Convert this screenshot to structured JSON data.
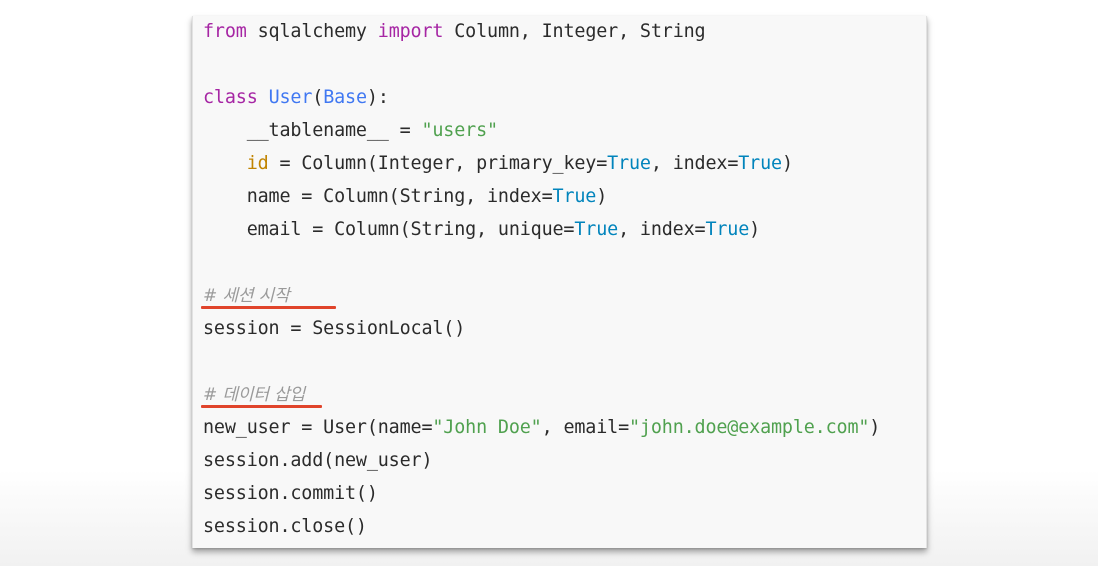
{
  "code_block": {
    "lines": [
      {
        "tokens": [
          {
            "t": "from",
            "k": "kw"
          },
          {
            "t": " sqlalchemy ",
            "k": "plain"
          },
          {
            "t": "import",
            "k": "kw"
          },
          {
            "t": " Column, Integer, String",
            "k": "plain"
          }
        ]
      },
      {
        "tokens": [
          {
            "t": "class",
            "k": "kw"
          },
          {
            "t": " ",
            "k": "plain"
          },
          {
            "t": "User",
            "k": "cls"
          },
          {
            "t": "(",
            "k": "plain"
          },
          {
            "t": "Base",
            "k": "cls"
          },
          {
            "t": "):",
            "k": "plain"
          }
        ]
      },
      {
        "tokens": [
          {
            "t": "    __tablename__ = ",
            "k": "plain"
          },
          {
            "t": "\"users\"",
            "k": "str"
          }
        ]
      },
      {
        "tokens": [
          {
            "t": "    ",
            "k": "plain"
          },
          {
            "t": "id",
            "k": "attr"
          },
          {
            "t": " = Column(Integer, primary_key=",
            "k": "plain"
          },
          {
            "t": "True",
            "k": "bool"
          },
          {
            "t": ", index=",
            "k": "plain"
          },
          {
            "t": "True",
            "k": "bool"
          },
          {
            "t": ")",
            "k": "plain"
          }
        ]
      },
      {
        "tokens": [
          {
            "t": "    name = Column(String, index=",
            "k": "plain"
          },
          {
            "t": "True",
            "k": "bool"
          },
          {
            "t": ")",
            "k": "plain"
          }
        ]
      },
      {
        "tokens": [
          {
            "t": "    email = Column(String, unique=",
            "k": "plain"
          },
          {
            "t": "True",
            "k": "bool"
          },
          {
            "t": ", index=",
            "k": "plain"
          },
          {
            "t": "True",
            "k": "bool"
          },
          {
            "t": ")",
            "k": "plain"
          }
        ]
      },
      {
        "tokens": [
          {
            "t": "# 세션 시작",
            "k": "cmt"
          }
        ]
      },
      {
        "tokens": [
          {
            "t": "session = SessionLocal()",
            "k": "plain"
          }
        ]
      },
      {
        "tokens": [
          {
            "t": "# 데이터 삽입",
            "k": "cmt"
          }
        ]
      },
      {
        "tokens": [
          {
            "t": "new_user = User(name=",
            "k": "plain"
          },
          {
            "t": "\"John Doe\"",
            "k": "str"
          },
          {
            "t": ", email=",
            "k": "plain"
          },
          {
            "t": "\"john.doe@example.com\"",
            "k": "str"
          },
          {
            "t": ")",
            "k": "plain"
          }
        ]
      },
      {
        "tokens": [
          {
            "t": "session.add(new_user)",
            "k": "plain"
          }
        ]
      },
      {
        "tokens": [
          {
            "t": "session.commit()",
            "k": "plain"
          }
        ]
      },
      {
        "tokens": [
          {
            "t": "session.close()",
            "k": "plain"
          }
        ]
      }
    ]
  },
  "colors": {
    "keyword": "#a626a4",
    "class_name": "#4078f2",
    "string": "#50a14f",
    "boolean": "#0184bc",
    "attribute": "#c18401",
    "comment": "#9a9a9a",
    "annotation_underline": "#e0442b"
  }
}
